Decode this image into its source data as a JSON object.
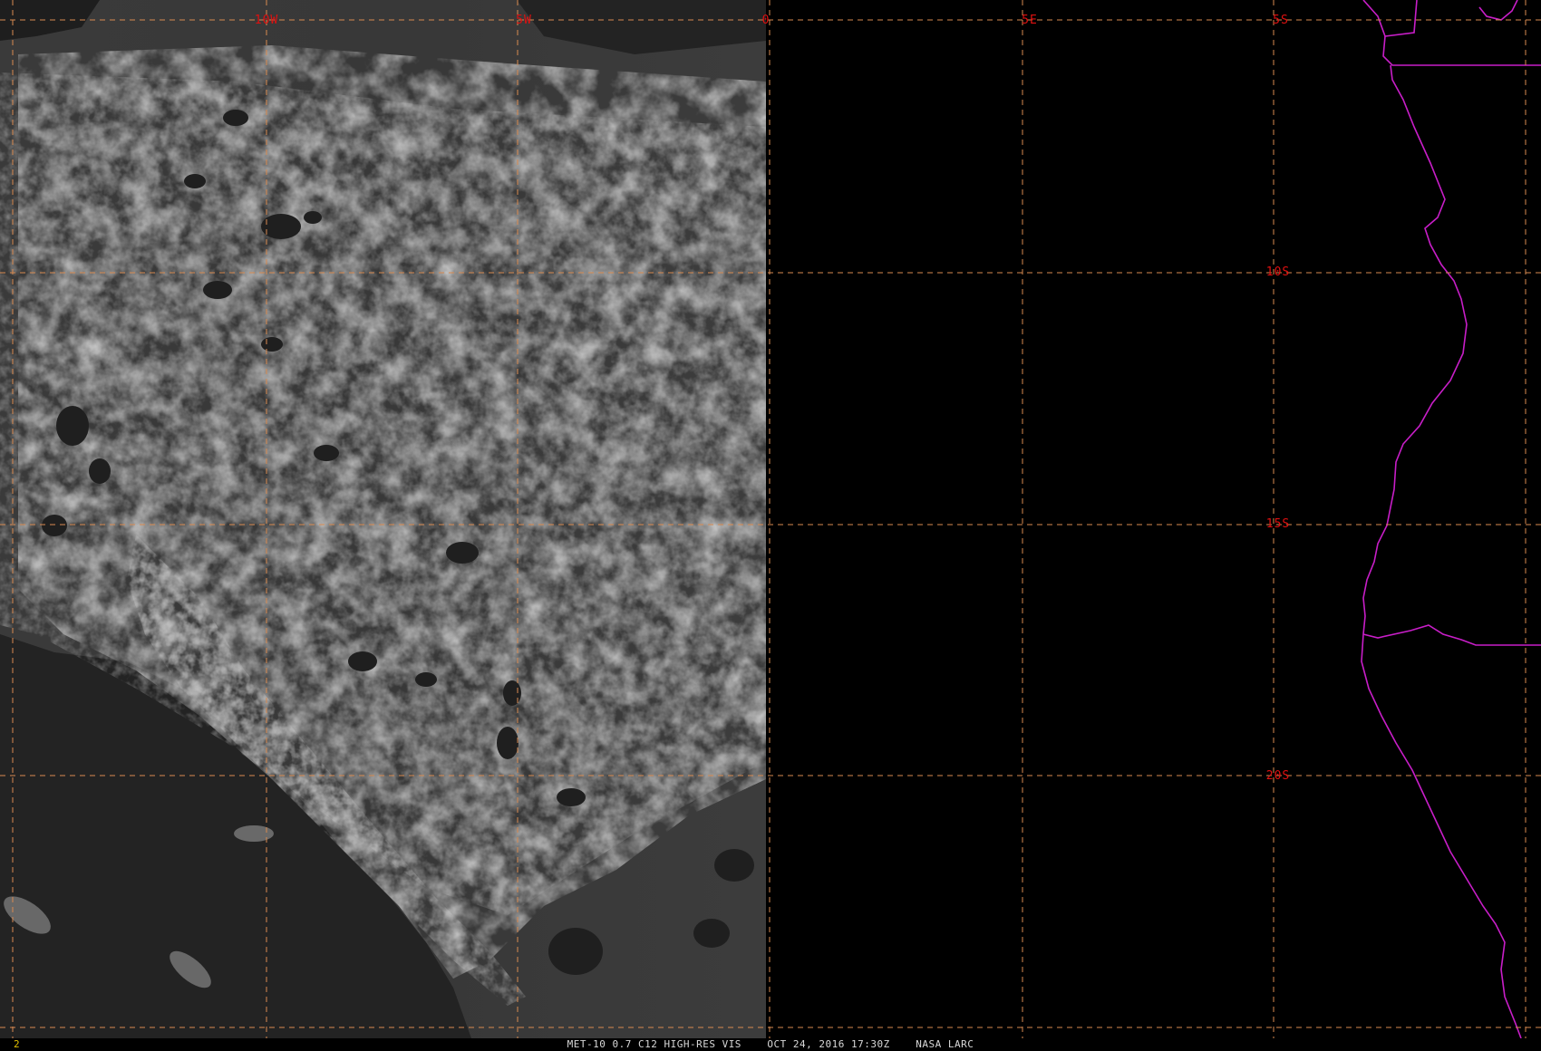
{
  "image": {
    "type": "satellite visible imagery with lat/lon grid overlay",
    "colors": {
      "background": "#000000",
      "grid_lines": "#d88a50",
      "grid_labels": "#e01010",
      "coastline": "#c81ec8",
      "caption_text": "#d8d8d8",
      "frame_number": "#e0c000"
    }
  },
  "grid": {
    "longitude_labels": [
      "10W",
      "5W",
      "0",
      "5E"
    ],
    "latitude_labels": [
      "5S",
      "10S",
      "15S",
      "20S"
    ]
  },
  "status_bar": {
    "frame_number": "2",
    "caption": "MET-10 0.7 C12 HIGH-RES VIS    OCT 24, 2016 17:30Z    NASA LARC"
  }
}
